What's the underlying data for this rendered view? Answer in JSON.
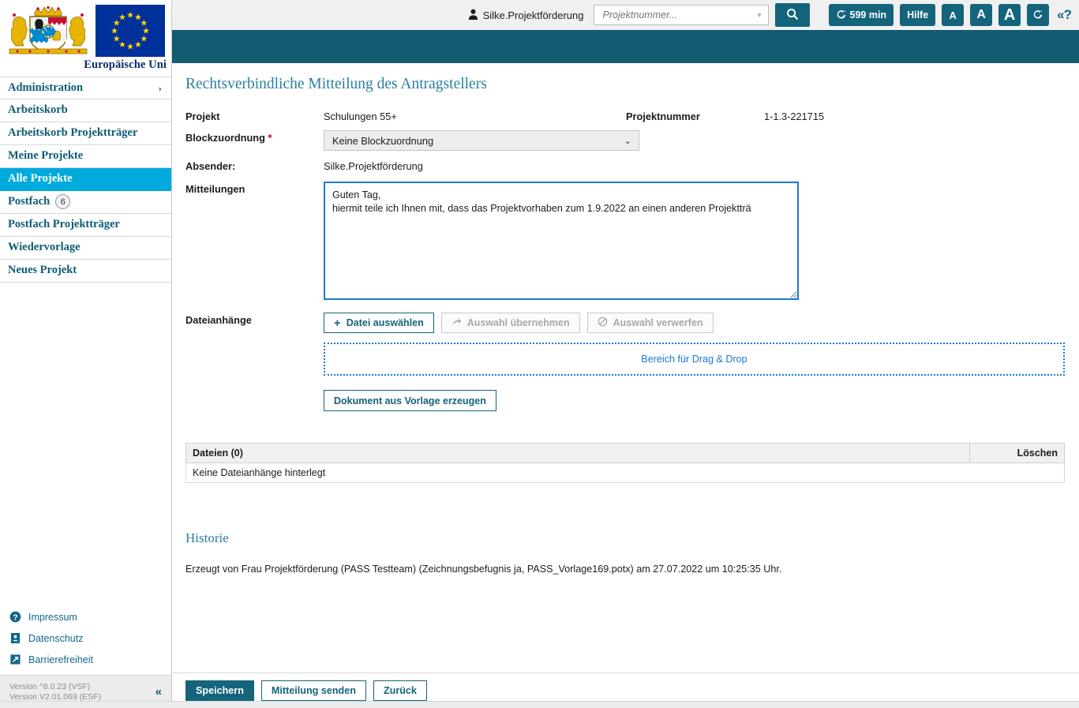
{
  "brand": {
    "eu_caption": "Europäische Uni",
    "coat_label": "bavaria-coat-of-arms",
    "accent_teal": "#125b70",
    "accent_dark_teal": "#14647c",
    "accent_cyan": "#00aadd",
    "accent_blue": "#1a7ad4",
    "link_blue": "#2b7fa3"
  },
  "topbar": {
    "user_name": "Silke.Projektförderung",
    "search_placeholder": "Projektnummer...",
    "search_value": "",
    "search_button_label": "",
    "session_timer": "599 min",
    "help_label": "Hilfe",
    "font_small": "A",
    "font_medium": "A",
    "font_large": "A",
    "refresh_label": "",
    "help_toggle_label": "«?"
  },
  "sidebar": {
    "items": [
      {
        "label": "Administration",
        "active": false,
        "chevron": "›",
        "badge": null
      },
      {
        "label": "Arbeitskorb",
        "active": false,
        "chevron": null,
        "badge": null
      },
      {
        "label": "Arbeitskorb Projektträger",
        "active": false,
        "chevron": null,
        "badge": null
      },
      {
        "label": "Meine Projekte",
        "active": false,
        "chevron": null,
        "badge": null
      },
      {
        "label": "Alle Projekte",
        "active": true,
        "chevron": null,
        "badge": null
      },
      {
        "label": "Postfach",
        "active": false,
        "chevron": null,
        "badge": "6"
      },
      {
        "label": "Postfach Projektträger",
        "active": false,
        "chevron": null,
        "badge": null
      },
      {
        "label": "Wiedervorlage",
        "active": false,
        "chevron": null,
        "badge": null
      },
      {
        "label": "Neues Projekt",
        "active": false,
        "chevron": null,
        "badge": null
      }
    ],
    "links": [
      {
        "label": "Impressum",
        "icon": "question-circle-icon"
      },
      {
        "label": "Datenschutz",
        "icon": "privacy-document-icon"
      },
      {
        "label": "Barrierefreiheit",
        "icon": "accessibility-arrow-icon"
      }
    ],
    "version_line1": "Version ^8.0.23 (VSF)",
    "version_line2": "Version V2.01.069 (ESF)",
    "collapse_label": "«"
  },
  "main": {
    "page_title": "Rechtsverbindliche Mitteilung des Antragstellers",
    "fields": {
      "projekt_label": "Projekt",
      "projekt_value": "Schulungen 55+",
      "projektnummer_label": "Projektnummer",
      "projektnummer_value": "1-1.3-221715",
      "blockzuordnung_label": "Blockzuordnung",
      "blockzuordnung_required": "*",
      "blockzuordnung_value": "Keine Blockzuordnung",
      "absender_label": "Absender:",
      "absender_value": "Silke.Projektförderung",
      "mitteilungen_label": "Mitteilungen",
      "mitteilungen_value": "Guten Tag,\nhiermit teile ich Ihnen mit, dass das Projektvorhaben zum 1.9.2022 an einen anderen Projektträ"
    },
    "attachments": {
      "label": "Dateianhänge",
      "choose_file_label": "Datei auswählen",
      "apply_selection_label": "Auswahl übernehmen",
      "discard_selection_label": "Auswahl verwerfen",
      "dropzone_label": "Bereich für Drag & Drop",
      "template_button_label": "Dokument aus Vorlage erzeugen"
    },
    "files_table": {
      "col_files": "Dateien (0)",
      "col_delete": "Löschen",
      "empty_message": "Keine Dateianhänge hinterlegt"
    },
    "history": {
      "title": "Historie",
      "entry": "Erzeugt von Frau Projektförderung (PASS Testteam) (Zeichnungsbefugnis ja, PASS_Vorlage169.potx) am 27.07.2022 um 10:25:35 Uhr."
    }
  },
  "footer": {
    "save_label": "Speichern",
    "send_label": "Mitteilung senden",
    "back_label": "Zurück"
  }
}
